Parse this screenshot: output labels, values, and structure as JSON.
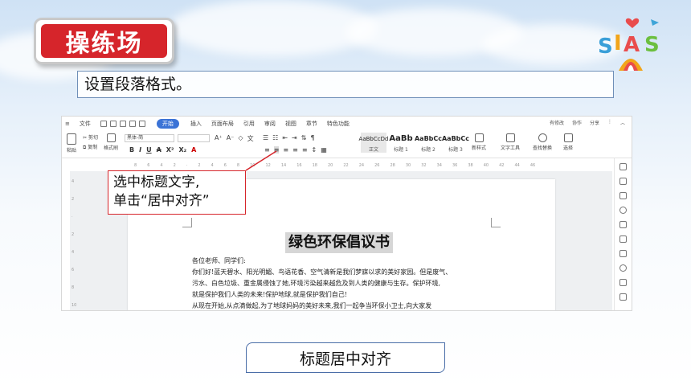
{
  "header": {
    "title": "操练场"
  },
  "instruction": "设置段落格式。",
  "app": {
    "menu": {
      "file": "文件",
      "tabs": [
        "开始",
        "插入",
        "页面布局",
        "引用",
        "审阅",
        "视图",
        "章节",
        "特色功能"
      ],
      "active_tab": "开始",
      "right": [
        "有修改",
        "协作",
        "分享"
      ]
    },
    "ribbon": {
      "paste": "粘贴",
      "cut": "剪切",
      "copy": "复制",
      "format_painter": "格式刷",
      "font_name": "黑体-简",
      "styles": [
        {
          "sample": "AaBbCcDd",
          "label": "正文"
        },
        {
          "sample": "AaBb",
          "label": "标题 1"
        },
        {
          "sample": "AaBbCc",
          "label": "标题 2"
        },
        {
          "sample": "AaBbCc",
          "label": "标题 3"
        }
      ],
      "new_style": "新样式",
      "text_tools": "文字工具",
      "find_replace": "查找替换",
      "select": "选择"
    },
    "ruler_ticks": [
      "8",
      "6",
      "4",
      "2",
      "",
      "2",
      "4",
      "6",
      "8",
      "10",
      "12",
      "14",
      "16",
      "18",
      "20",
      "22",
      "24",
      "26",
      "28",
      "30",
      "32",
      "34",
      "36",
      "38",
      "40",
      "42",
      "44",
      "46"
    ],
    "left_ruler_ticks": [
      "4",
      "2",
      "",
      "2",
      "4",
      "6",
      "8",
      "10"
    ],
    "document": {
      "title": "绿色环保倡议书",
      "lines": [
        "各位老师、同学们:",
        "你们好!蓝天碧水、阳光明媚、鸟语花香、空气清新是我们梦寐以求的美好家园。但是废气、",
        "污水、白色垃圾、重金属侵蚀了她,环境污染越来越危及到人类的健康与生存。保护环境,",
        "就是保护我们人类的未来!保护地球,就是保护我们自己!",
        "从现在开始,从点滴做起,为了地球妈妈的美好未来,我们一起争当环保小卫士,向大家发"
      ]
    }
  },
  "callout": {
    "line1": "选中标题文字,",
    "line2": "单击“居中对齐”"
  },
  "caption": "标题居中对齐",
  "colors": {
    "accent_red": "#d6252b",
    "wps_blue": "#3b73d6",
    "caption_border": "#4a6ea8"
  }
}
